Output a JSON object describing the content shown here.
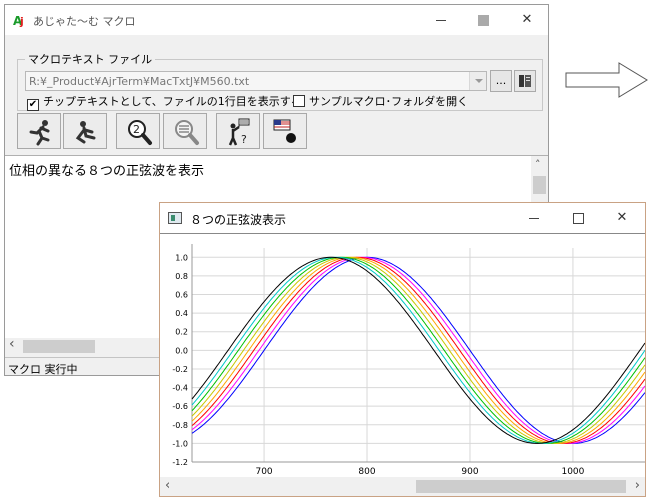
{
  "main_window": {
    "title": "あじゃた〜む マクロ",
    "group_label": "マクロテキスト ファイル",
    "file_path": "R:¥_Product¥AjrTerm¥MacTxtJ¥M560.txt",
    "browse_label": "...",
    "check_tooltip_label": "チップテキストとして、ファイルの1行目を表示する",
    "check_tooltip_checked": true,
    "check_sample_label": "サンプルマクロ･フォルダを開く",
    "check_sample_checked": false,
    "editor_text": "位相の異なる８つの正弦波を表示",
    "status": "マクロ 実行中",
    "icons": [
      "run-icon",
      "stop-icon",
      "search-2-icon",
      "search-list-icon",
      "help-flag-icon",
      "flag-record-icon"
    ]
  },
  "graph_window": {
    "title": "８つの正弦波表示",
    "close_glyph": "✕"
  },
  "chart_data": {
    "type": "line",
    "title": "",
    "xlabel": "",
    "ylabel": "",
    "xlim": [
      630,
      1070
    ],
    "ylim": [
      -1.2,
      1.1
    ],
    "xticks": [
      700,
      800,
      900,
      1000
    ],
    "yticks": [
      "1.0",
      "0.8",
      "0.6",
      "0.4",
      "0.2",
      "0.0",
      "-0.2",
      "-0.4",
      "-0.6",
      "-0.8",
      "-1.0",
      "-1.2"
    ],
    "grid": true,
    "period": 400,
    "series": [
      {
        "color": "#0000ff",
        "peak_x": 800
      },
      {
        "color": "#ff00ff",
        "peak_x": 795
      },
      {
        "color": "#ff0000",
        "peak_x": 790
      },
      {
        "color": "#ffa500",
        "peak_x": 785
      },
      {
        "color": "#c8c800",
        "peak_x": 780
      },
      {
        "color": "#00c000",
        "peak_x": 775
      },
      {
        "color": "#00c8c8",
        "peak_x": 770
      },
      {
        "color": "#000000",
        "peak_x": 765
      }
    ]
  }
}
